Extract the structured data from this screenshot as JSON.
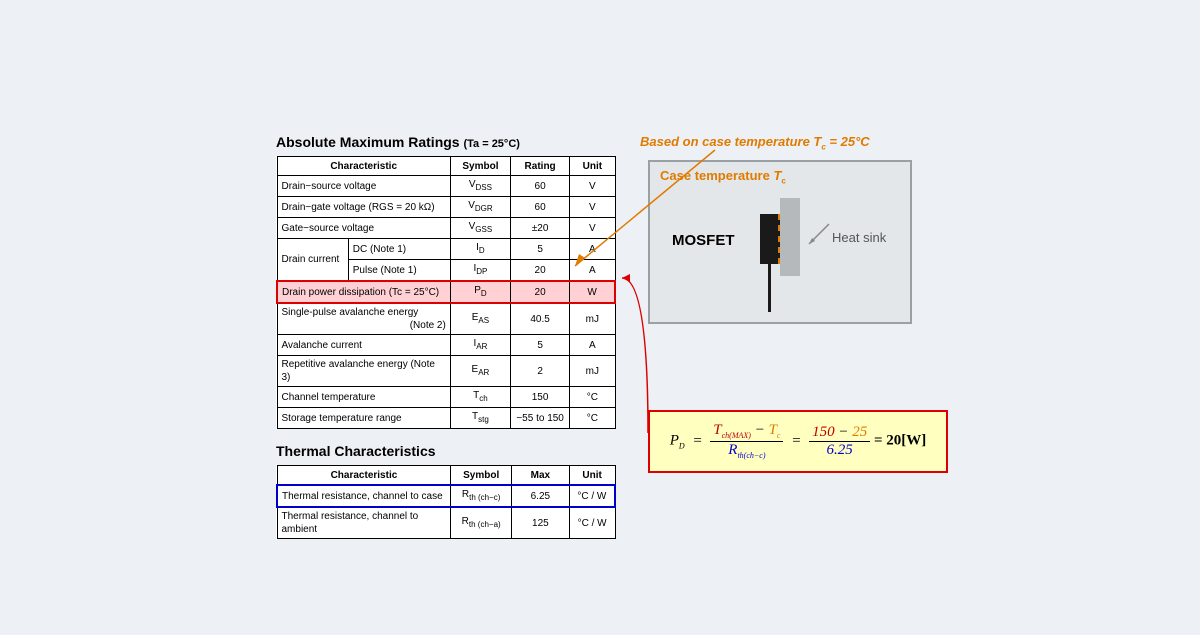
{
  "headings": {
    "abs_title": "Absolute Maximum Ratings ",
    "abs_cond": "(Ta = 25°C)",
    "thermal_title": "Thermal Characteristics"
  },
  "annot": {
    "prefix": "Based on case temperature ",
    "var": "T",
    "sub": "c",
    "suffix": " = 25°C"
  },
  "amr": {
    "head": {
      "char": "Characteristic",
      "symbol": "Symbol",
      "rating": "Rating",
      "unit": "Unit"
    },
    "rows": [
      {
        "char": "Drain−source voltage",
        "sym": "V",
        "sub": "DSS",
        "rating": "60",
        "unit": "V"
      },
      {
        "char": "Drain−gate voltage (RGS = 20 kΩ)",
        "sym": "V",
        "sub": "DGR",
        "rating": "60",
        "unit": "V"
      },
      {
        "char": "Gate−source voltage",
        "sym": "V",
        "sub": "GSS",
        "rating": "±20",
        "unit": "V"
      }
    ],
    "drain": {
      "label": "Drain current",
      "dc": {
        "cond": "DC    (Note 1)",
        "sym": "I",
        "sub": "D",
        "rating": "5",
        "unit": "A"
      },
      "pulse": {
        "cond": "Pulse (Note 1)",
        "sym": "I",
        "sub": "DP",
        "rating": "20",
        "unit": "A"
      }
    },
    "pd": {
      "char": "Drain power dissipation (Tc = 25°C)",
      "sym": "P",
      "sub": "D",
      "rating": "20",
      "unit": "W"
    },
    "tail": [
      {
        "char": "Single-pulse avalanche energy",
        "note": "(Note 2)",
        "sym": "E",
        "sub": "AS",
        "rating": "40.5",
        "unit": "mJ"
      },
      {
        "char": "Avalanche current",
        "sym": "I",
        "sub": "AR",
        "rating": "5",
        "unit": "A"
      },
      {
        "char": "Repetitive avalanche energy  (Note 3)",
        "sym": "E",
        "sub": "AR",
        "rating": "2",
        "unit": "mJ"
      },
      {
        "char": "Channel temperature",
        "sym": "T",
        "sub": "ch",
        "rating": "150",
        "unit": "°C"
      },
      {
        "char": "Storage temperature range",
        "sym": "T",
        "sub": "stg",
        "rating": "−55 to 150",
        "unit": "°C"
      }
    ]
  },
  "thermal": {
    "head": {
      "char": "Characteristic",
      "symbol": "Symbol",
      "max": "Max",
      "unit": "Unit"
    },
    "rows": [
      {
        "char": "Thermal resistance, channel to case",
        "sym": "R",
        "sub": "th (ch−c)",
        "max": "6.25",
        "unit": "°C / W",
        "hl": "blue"
      },
      {
        "char": "Thermal resistance, channel to ambient",
        "sym": "R",
        "sub": "th (ch−a)",
        "max": "125",
        "unit": "°C / W"
      }
    ]
  },
  "diagram": {
    "title_prefix": "Case temperature ",
    "title_var": "T",
    "title_sub": "c",
    "mosfet": "MOSFET",
    "heatsink": "Heat sink"
  },
  "formula": {
    "lhs": "P",
    "lhs_sub": "D",
    "num1": "T",
    "num1_sub": "ch(MAX)",
    "minus": " − ",
    "num2": "T",
    "num2_sub": "c",
    "den": "R",
    "den_sub": "th(ch−c)",
    "n1": "150",
    "n2": "25",
    "d": "6.25",
    "res": "= 20[W]"
  }
}
